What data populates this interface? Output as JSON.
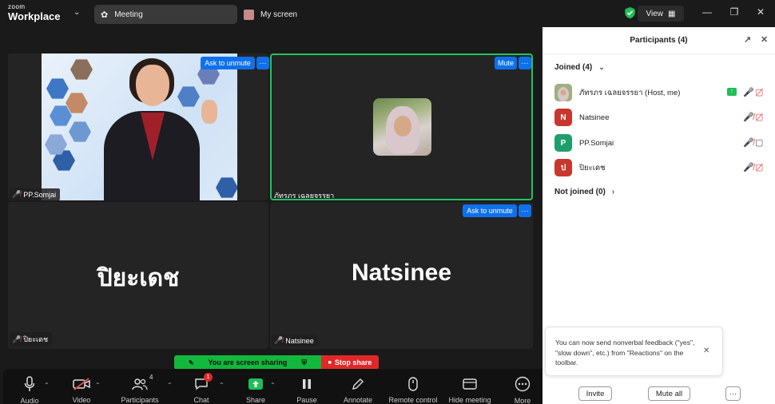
{
  "titlebar": {
    "brand_top": "zoom",
    "brand_bottom": "Workplace",
    "tab_meeting": "Meeting",
    "tab_screen": "My screen",
    "view_label": "View"
  },
  "tiles": {
    "top_left": {
      "name": "PP.Somjai",
      "ask_unmute": "Ask to unmute",
      "more": "···"
    },
    "top_right": {
      "name": "ภัทรภร เฉลยจรรยา",
      "mute": "Mute",
      "more": "···"
    },
    "bottom_left": {
      "name": "ปิยะเดช",
      "big_name": "ปิยะเดช"
    },
    "bottom_right": {
      "name": "Natsinee",
      "big_name": "Natsinee",
      "ask_unmute": "Ask to unmute",
      "more": "···"
    }
  },
  "share": {
    "sharing_text": "You are screen sharing",
    "stop_label": "Stop share"
  },
  "toolbar": {
    "audio": "Audio",
    "video": "Video",
    "participants": "Participants",
    "participants_count": "4",
    "chat": "Chat",
    "chat_badge": "1",
    "share": "Share",
    "pause": "Pause",
    "annotate": "Annotate",
    "remote_control": "Remote control",
    "hide_meeting": "Hide meeting",
    "more": "More"
  },
  "panel": {
    "title": "Participants (4)",
    "joined_label": "Joined (4)",
    "not_joined_label": "Not joined (0)",
    "participants": [
      {
        "name": "ภัทรภร เฉลยจรรยา (Host, me)",
        "initial": "",
        "color": "#cfc6c9"
      },
      {
        "name": "Natsinee",
        "initial": "N",
        "color": "#c8372d"
      },
      {
        "name": "PP.Somjai",
        "initial": "P",
        "color": "#1f9e6d"
      },
      {
        "name": "ปิยะเดช",
        "initial": "ป",
        "color": "#c8372d"
      }
    ],
    "toast_text": "You can now send nonverbal feedback (\"yes\", \"slow down\", etc.) from \"Reactions\" on the toolbar.",
    "invite": "Invite",
    "mute_all": "Mute all",
    "more": "···"
  },
  "colors": {
    "accent_blue": "#0e71eb",
    "share_green": "#12b83c",
    "stop_red": "#e02828",
    "active_speaker_border": "#22c55e"
  }
}
